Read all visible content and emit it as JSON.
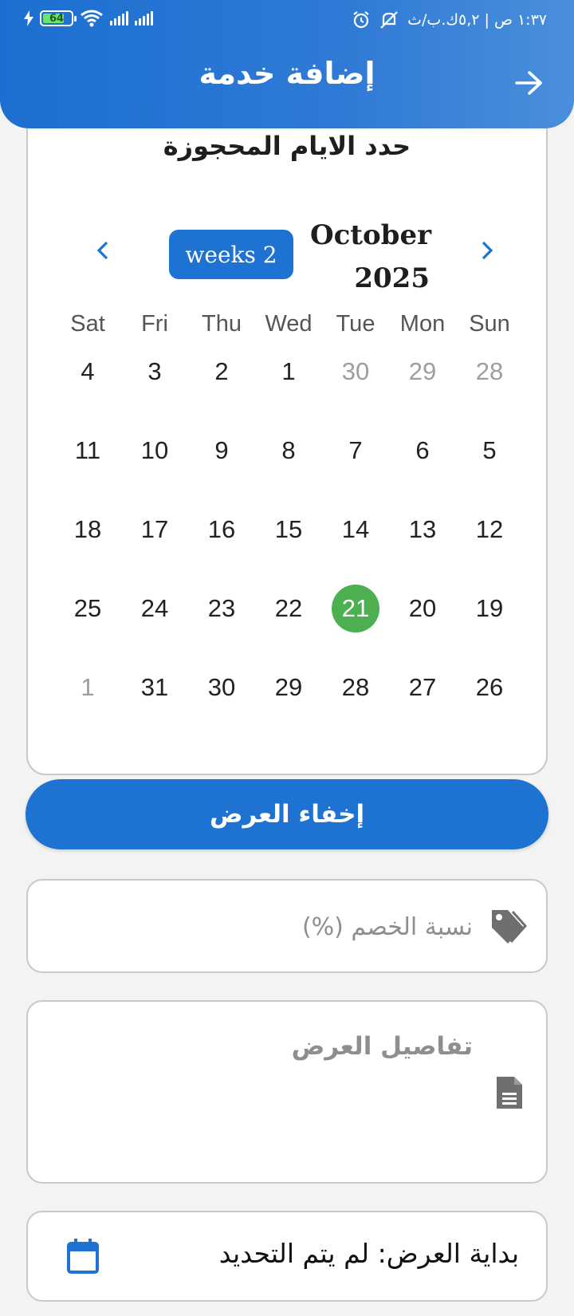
{
  "status_bar": {
    "battery": "64",
    "time_text": "١:٣٧ ص | ٥,٢ك.ب/ث"
  },
  "header": {
    "title": "إضافة خدمة"
  },
  "calendar": {
    "heading": "حدد الايام المحجوزة",
    "format_button": "weeks 2",
    "month": "October",
    "year": "2025",
    "weekdays": [
      "Sat",
      "Fri",
      "Thu",
      "Wed",
      "Tue",
      "Mon",
      "Sun"
    ],
    "weeks": [
      [
        {
          "d": "4"
        },
        {
          "d": "3"
        },
        {
          "d": "2"
        },
        {
          "d": "1"
        },
        {
          "d": "30",
          "out": true
        },
        {
          "d": "29",
          "out": true
        },
        {
          "d": "28",
          "out": true
        }
      ],
      [
        {
          "d": "11"
        },
        {
          "d": "10"
        },
        {
          "d": "9"
        },
        {
          "d": "8"
        },
        {
          "d": "7"
        },
        {
          "d": "6"
        },
        {
          "d": "5"
        }
      ],
      [
        {
          "d": "18"
        },
        {
          "d": "17"
        },
        {
          "d": "16"
        },
        {
          "d": "15"
        },
        {
          "d": "14"
        },
        {
          "d": "13"
        },
        {
          "d": "12"
        }
      ],
      [
        {
          "d": "25"
        },
        {
          "d": "24"
        },
        {
          "d": "23"
        },
        {
          "d": "22"
        },
        {
          "d": "21",
          "today": true
        },
        {
          "d": "20"
        },
        {
          "d": "19"
        }
      ],
      [
        {
          "d": "1",
          "out": true
        },
        {
          "d": "31"
        },
        {
          "d": "30"
        },
        {
          "d": "29"
        },
        {
          "d": "28"
        },
        {
          "d": "27"
        },
        {
          "d": "26"
        }
      ]
    ],
    "today_color": "#4caf50"
  },
  "hide_button": {
    "label": "إخفاء العرض"
  },
  "discount_field": {
    "placeholder": "نسبة الخصم (%)",
    "icon": "tag-icon"
  },
  "details_field": {
    "placeholder": "تفاصيل العرض",
    "icon": "document-icon"
  },
  "start_date": {
    "label": "بداية العرض: لم يتم التحديد",
    "icon": "calendar-icon"
  },
  "colors": {
    "primary": "#1e73d2",
    "today": "#4caf50",
    "background": "#f3f3f3"
  }
}
